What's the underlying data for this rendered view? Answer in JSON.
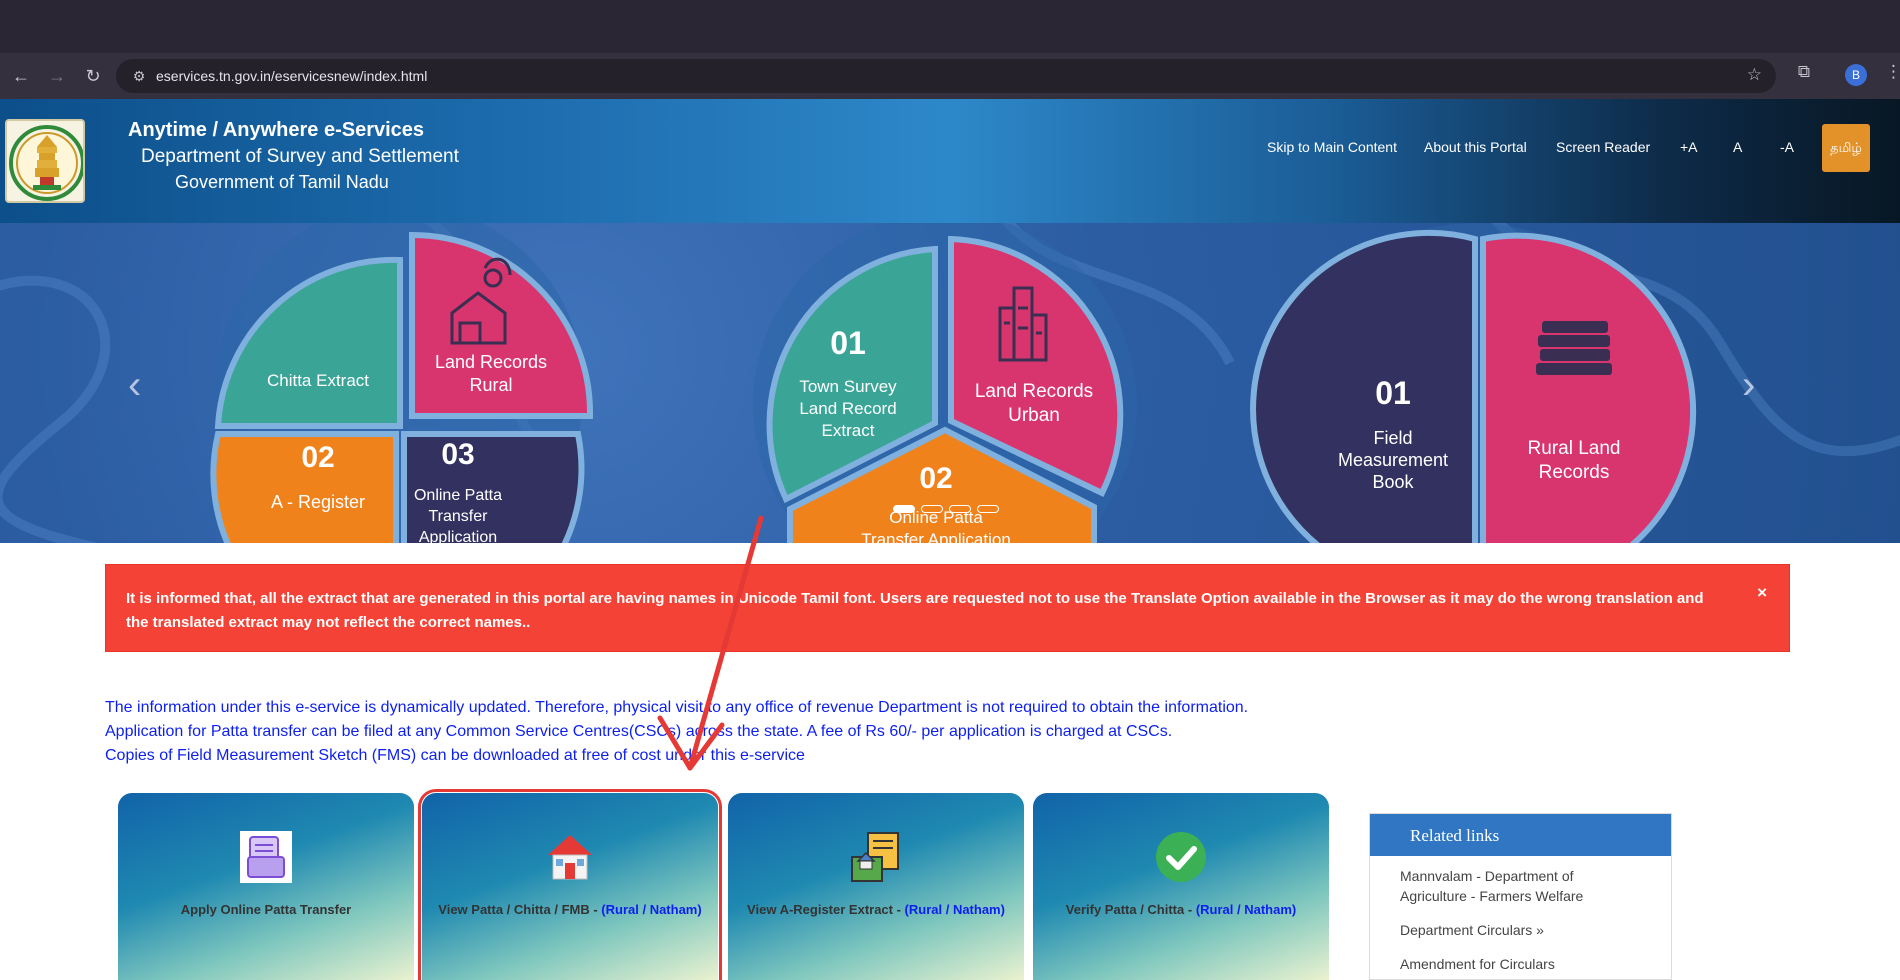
{
  "browser": {
    "url": "eservices.tn.gov.in/eservicesnew/index.html",
    "profile_initial": "B"
  },
  "header": {
    "title": "Anytime / Anywhere e-Services",
    "department": "Department of Survey and Settlement",
    "government": "Government of Tamil Nadu",
    "nav": {
      "skip": "Skip to Main Content",
      "about": "About this Portal",
      "reader": "Screen Reader",
      "font_plus": "+A",
      "font_normal": "A",
      "font_minus": "-A",
      "tamil": "தமிழ்"
    }
  },
  "carousel": {
    "slide1": {
      "chitta": "Chitta Extract",
      "land_rural_1": "Land Records",
      "land_rural_2": "Rural",
      "num2": "02",
      "a_register": "A - Register",
      "num3": "03",
      "online_1": "Online Patta",
      "online_2": "Transfer",
      "online_3": "Application"
    },
    "slide2": {
      "num1": "01",
      "town_1": "Town Survey",
      "town_2": "Land Record",
      "town_3": "Extract",
      "urban_1": "Land Records",
      "urban_2": "Urban",
      "num2": "02",
      "online_1": "Online Patta",
      "online_2": "Transfer Application"
    },
    "slide3": {
      "num1": "01",
      "fmb_1": "Field",
      "fmb_2": "Measurement",
      "fmb_3": "Book",
      "rural_1": "Rural Land",
      "rural_2": "Records"
    }
  },
  "alert": {
    "text": "It is informed that, all the extract that are generated in this portal are having names in Unicode Tamil font. Users are requested not to use the Translate Option available in the Browser as it may do the wrong translation and the translated extract may not reflect the correct names..",
    "close": "×"
  },
  "info": {
    "line1": "The information under this e-service is dynamically updated. Therefore, physical visit to any office of revenue Department is not required to obtain the information.",
    "line2": "Application for Patta transfer can be filed at any Common Service Centres(CSCs) across the state. A fee of Rs 60/- per application is charged at CSCs.",
    "line3": "Copies of Field Measurement Sketch (FMS) can be downloaded at free of cost under this e-service"
  },
  "cards": [
    {
      "label": "Apply Online Patta Transfer",
      "suffix": ""
    },
    {
      "label": "View Patta / Chitta / FMB - ",
      "suffix": "(Rural / Natham)"
    },
    {
      "label": "View A-Register Extract - ",
      "suffix": "(Rural / Natham)"
    },
    {
      "label": "Verify Patta / Chitta - ",
      "suffix": "(Rural / Natham)"
    }
  ],
  "related": {
    "title": "Related links",
    "links": [
      "Mannvalam - Department of Agriculture - Farmers Welfare",
      "Department Circulars »",
      "Amendment for Circulars"
    ]
  },
  "colors": {
    "alert_red": "#f44336",
    "info_blue": "#0d1ff0",
    "related_head": "#3076c2",
    "tamil_orange": "#e3922a",
    "pie_teal": "#3aa597",
    "pie_pink": "#d8356e",
    "pie_orange": "#f0821c",
    "pie_navy": "#33315f"
  }
}
